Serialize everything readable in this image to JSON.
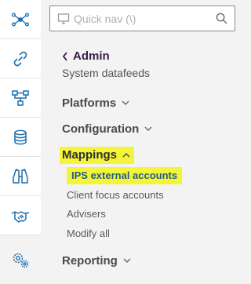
{
  "rail": {
    "items": [
      {
        "icon": "network-nodes-icon",
        "active": false
      },
      {
        "icon": "link-icon",
        "active": false
      },
      {
        "icon": "workflow-icon",
        "active": false
      },
      {
        "icon": "database-icon",
        "active": false
      },
      {
        "icon": "binoculars-icon",
        "active": false
      },
      {
        "icon": "handshake-icon",
        "active": false
      },
      {
        "icon": "gears-icon",
        "active": true
      }
    ]
  },
  "search": {
    "placeholder": "Quick nav (\\)"
  },
  "nav": {
    "back_label": "Admin",
    "subtitle": "System datafeeds",
    "sections": [
      {
        "label": "Platforms",
        "expanded": false
      },
      {
        "label": "Configuration",
        "expanded": false
      },
      {
        "label": "Mappings",
        "expanded": true,
        "highlighted": true,
        "items": [
          {
            "label": "IPS external accounts",
            "highlighted": true
          },
          {
            "label": "Client focus accounts"
          },
          {
            "label": "Advisers"
          },
          {
            "label": "Modify all"
          }
        ]
      },
      {
        "label": "Reporting",
        "expanded": false
      }
    ]
  },
  "colors": {
    "accent": "#1d6fae",
    "highlight": "#f4f53a",
    "active_rail": "#f3f3f3"
  }
}
